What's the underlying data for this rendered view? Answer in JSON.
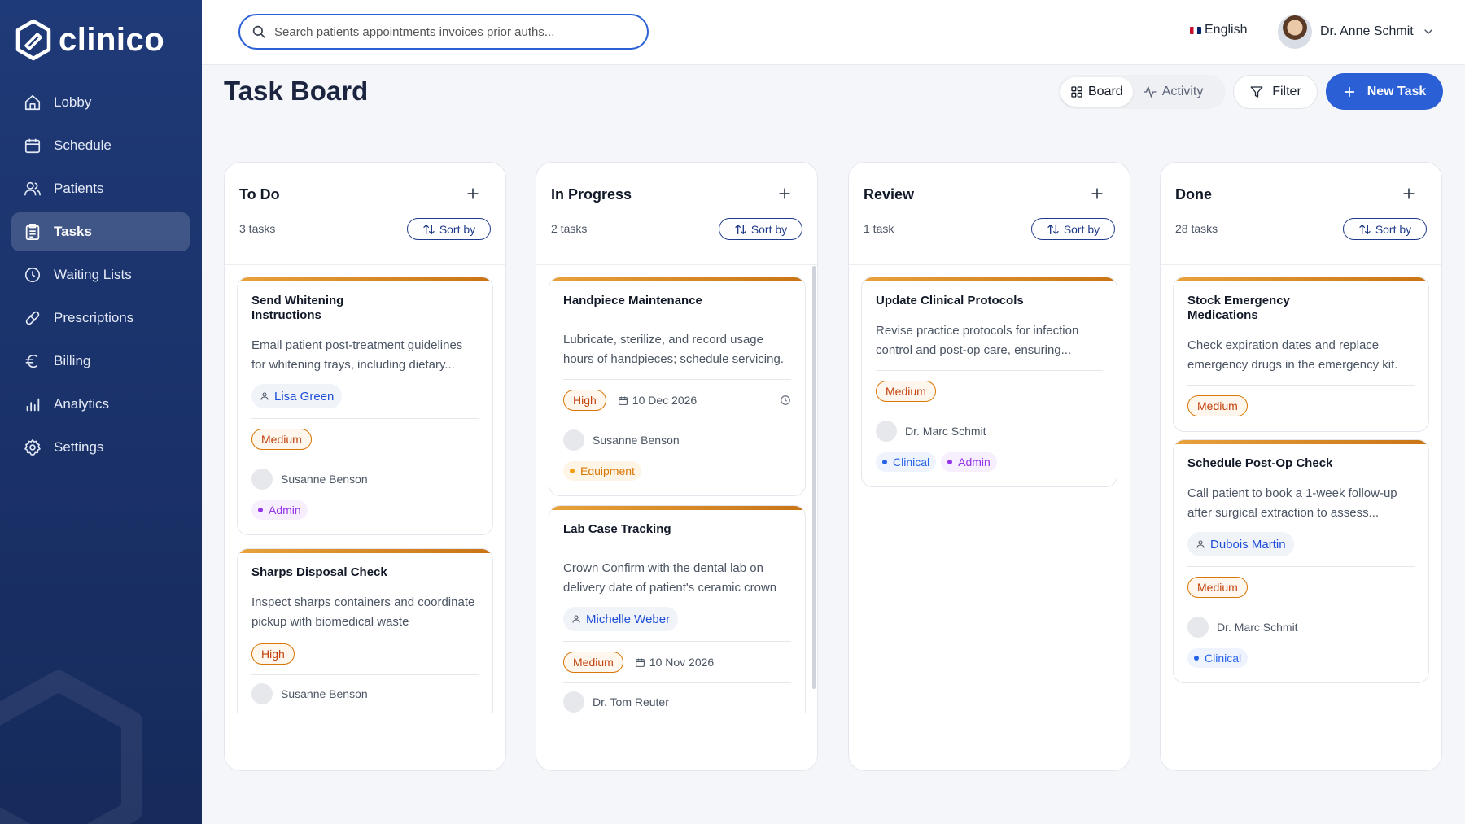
{
  "brand": {
    "name": "clinico"
  },
  "sidebar": {
    "items": [
      {
        "label": "Lobby",
        "icon": "home-icon"
      },
      {
        "label": "Schedule",
        "icon": "calendar-icon"
      },
      {
        "label": "Patients",
        "icon": "users-icon"
      },
      {
        "label": "Tasks",
        "icon": "clipboard-icon",
        "active": true
      },
      {
        "label": "Waiting Lists",
        "icon": "clock-icon"
      },
      {
        "label": "Prescriptions",
        "icon": "pill-icon"
      },
      {
        "label": "Billing",
        "icon": "euro-icon"
      },
      {
        "label": "Analytics",
        "icon": "bar-chart-icon"
      },
      {
        "label": "Settings",
        "icon": "gear-icon"
      }
    ]
  },
  "header": {
    "search_placeholder": "Search patients appointments invoices prior auths...",
    "language": "English",
    "user_name": "Dr. Anne Schmit"
  },
  "page": {
    "title": "Task Board"
  },
  "toolbar": {
    "board_label": "Board",
    "activity_label": "Activity",
    "filter_label": "Filter",
    "new_task_label": "New Task"
  },
  "columns": [
    {
      "title": "To Do",
      "count": "3 tasks",
      "sort_label": "Sort by",
      "cards": [
        {
          "title": "Send Whitening Instructions",
          "desc": "Email patient post-treatment guidelines for whitening trays, including dietary...",
          "assignee": "Lisa Green",
          "priority": "Medium",
          "person": "Susanne Benson",
          "tags": [
            "Admin"
          ]
        },
        {
          "title": "Sharps Disposal Check",
          "desc": "Inspect sharps containers and coordinate pickup with biomedical waste",
          "priority": "High",
          "person": "Susanne Benson"
        }
      ]
    },
    {
      "title": "In Progress",
      "count": "2 tasks",
      "sort_label": "Sort by",
      "cards": [
        {
          "title": "Handpiece Maintenance",
          "desc": "Lubricate, sterilize, and record usage hours of handpieces; schedule servicing.",
          "priority": "High",
          "date": "10 Dec 2026",
          "person": "Susanne Benson",
          "tags": [
            "Equipment"
          ]
        },
        {
          "title": "Lab Case Tracking",
          "desc": "Crown Confirm with the dental lab on delivery date of patient's ceramic crown",
          "assignee": "Michelle Weber",
          "priority": "Medium",
          "date": "10 Nov 2026",
          "person": "Dr. Tom Reuter"
        }
      ]
    },
    {
      "title": "Review",
      "count": "1 task",
      "sort_label": "Sort by",
      "cards": [
        {
          "title": "Update Clinical Protocols",
          "desc": "Revise practice protocols for infection control and post-op care, ensuring...",
          "priority": "Medium",
          "person": "Dr. Marc Schmit",
          "tags": [
            "Clinical",
            "Admin"
          ]
        }
      ]
    },
    {
      "title": "Done",
      "count": "28 tasks",
      "sort_label": "Sort by",
      "cards": [
        {
          "title": "Stock Emergency Medications",
          "desc": "Check expiration dates and replace emergency drugs in the emergency kit.",
          "priority": "Medium"
        },
        {
          "title": "Schedule Post-Op Check",
          "desc": "Call patient to book a 1-week follow-up after surgical extraction to assess...",
          "assignee": "Dubois Martin",
          "priority": "Medium",
          "person": "Dr. Marc Schmit",
          "tags": [
            "Clinical"
          ]
        }
      ]
    }
  ],
  "colors": {
    "sidebar": "#1f3a78",
    "primary": "#2a5fd6",
    "accent": "#e8a23b",
    "priority": "#d97706"
  }
}
